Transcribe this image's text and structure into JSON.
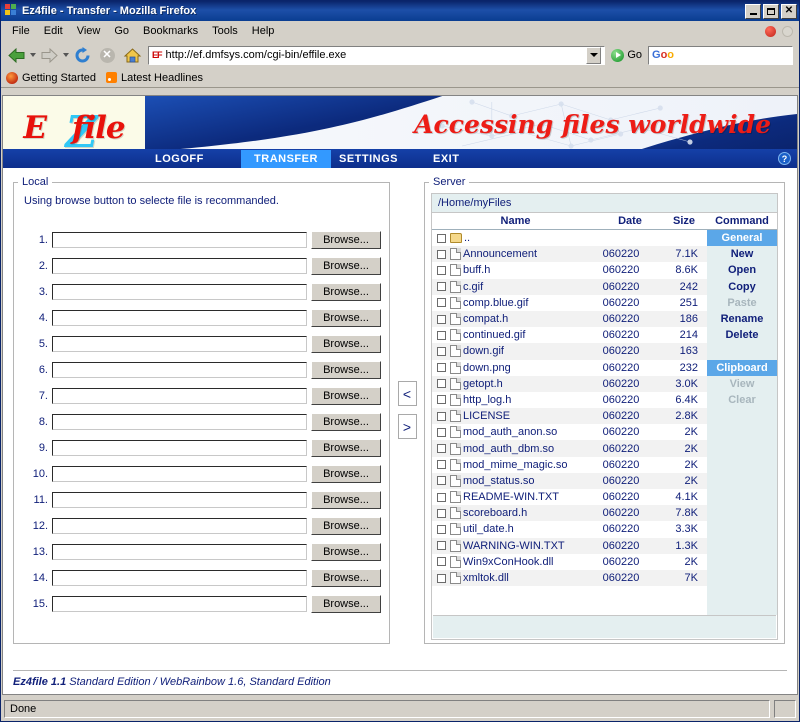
{
  "window": {
    "title": "Ez4file - Transfer - Mozilla Firefox",
    "minimize_label": "Minimize",
    "maximize_label": "Maximize",
    "close_label": "Close"
  },
  "menubar": {
    "items": [
      "File",
      "Edit",
      "View",
      "Go",
      "Bookmarks",
      "Tools",
      "Help"
    ]
  },
  "toolbar": {
    "back_label": "Back",
    "forward_label": "Forward",
    "reload_label": "Reload",
    "stop_label": "Stop",
    "home_label": "Home",
    "url": "http://ef.dmfsys.com/cgi-bin/effile.exe",
    "url_badge": "EF",
    "go_label": "Go",
    "search_placeholder": "",
    "search_value": "",
    "google_logo": [
      "G",
      "o",
      "o"
    ]
  },
  "bookmarks": [
    {
      "label": "Getting Started",
      "icon": "firefox-icon"
    },
    {
      "label": "Latest Headlines",
      "icon": "rss-icon"
    }
  ],
  "banner": {
    "logo_prefix": "E",
    "logo_z": "Z",
    "logo_suffix": "file",
    "tagline": "Accessing files worldwide",
    "help_label": "?"
  },
  "nav": {
    "items": [
      {
        "label": "LOGOFF",
        "active": false
      },
      {
        "label": "TRANSFER",
        "active": true
      },
      {
        "label": "SETTINGS",
        "active": false
      },
      {
        "label": "EXIT",
        "active": false
      }
    ]
  },
  "local": {
    "legend": "Local",
    "hint": "Using browse button to selecte file is recommanded.",
    "browse_label": "Browse...",
    "rows": [
      {
        "num": "1.",
        "value": ""
      },
      {
        "num": "2.",
        "value": ""
      },
      {
        "num": "3.",
        "value": ""
      },
      {
        "num": "4.",
        "value": ""
      },
      {
        "num": "5.",
        "value": ""
      },
      {
        "num": "6.",
        "value": ""
      },
      {
        "num": "7.",
        "value": ""
      },
      {
        "num": "8.",
        "value": ""
      },
      {
        "num": "9.",
        "value": ""
      },
      {
        "num": "10.",
        "value": ""
      },
      {
        "num": "11.",
        "value": ""
      },
      {
        "num": "12.",
        "value": ""
      },
      {
        "num": "13.",
        "value": ""
      },
      {
        "num": "14.",
        "value": ""
      },
      {
        "num": "15.",
        "value": ""
      }
    ]
  },
  "transfer": {
    "to_local_label": "<",
    "to_server_label": ">"
  },
  "server": {
    "legend": "Server",
    "path": "/Home/myFiles",
    "columns": {
      "name": "Name",
      "date": "Date",
      "size": "Size",
      "command": "Command"
    },
    "files": [
      {
        "name": "..",
        "date": "",
        "size": "",
        "icon": "folder-icon"
      },
      {
        "name": "Announcement",
        "date": "060220",
        "size": "7.1K",
        "icon": "file-icon"
      },
      {
        "name": "buff.h",
        "date": "060220",
        "size": "8.6K",
        "icon": "file-icon"
      },
      {
        "name": "c.gif",
        "date": "060220",
        "size": "242",
        "icon": "file-icon"
      },
      {
        "name": "comp.blue.gif",
        "date": "060220",
        "size": "251",
        "icon": "file-icon"
      },
      {
        "name": "compat.h",
        "date": "060220",
        "size": "186",
        "icon": "file-icon"
      },
      {
        "name": "continued.gif",
        "date": "060220",
        "size": "214",
        "icon": "file-icon"
      },
      {
        "name": "down.gif",
        "date": "060220",
        "size": "163",
        "icon": "file-icon"
      },
      {
        "name": "down.png",
        "date": "060220",
        "size": "232",
        "icon": "file-icon"
      },
      {
        "name": "getopt.h",
        "date": "060220",
        "size": "3.0K",
        "icon": "file-icon"
      },
      {
        "name": "http_log.h",
        "date": "060220",
        "size": "6.4K",
        "icon": "file-icon"
      },
      {
        "name": "LICENSE",
        "date": "060220",
        "size": "2.8K",
        "icon": "file-icon"
      },
      {
        "name": "mod_auth_anon.so",
        "date": "060220",
        "size": "2K",
        "icon": "file-icon"
      },
      {
        "name": "mod_auth_dbm.so",
        "date": "060220",
        "size": "2K",
        "icon": "file-icon"
      },
      {
        "name": "mod_mime_magic.so",
        "date": "060220",
        "size": "2K",
        "icon": "file-icon"
      },
      {
        "name": "mod_status.so",
        "date": "060220",
        "size": "2K",
        "icon": "file-icon"
      },
      {
        "name": "README-WIN.TXT",
        "date": "060220",
        "size": "4.1K",
        "icon": "file-icon"
      },
      {
        "name": "scoreboard.h",
        "date": "060220",
        "size": "7.8K",
        "icon": "file-icon"
      },
      {
        "name": "util_date.h",
        "date": "060220",
        "size": "3.3K",
        "icon": "file-icon"
      },
      {
        "name": "WARNING-WIN.TXT",
        "date": "060220",
        "size": "1.3K",
        "icon": "file-icon"
      },
      {
        "name": "Win9xConHook.dll",
        "date": "060220",
        "size": "2K",
        "icon": "file-icon"
      },
      {
        "name": "xmltok.dll",
        "date": "060220",
        "size": "7K",
        "icon": "file-icon"
      }
    ],
    "commands": [
      {
        "label": "General",
        "type": "header",
        "disabled": false
      },
      {
        "label": "New",
        "type": "item",
        "disabled": false
      },
      {
        "label": "Open",
        "type": "item",
        "disabled": false
      },
      {
        "label": "Copy",
        "type": "item",
        "disabled": false
      },
      {
        "label": "Paste",
        "type": "item",
        "disabled": true
      },
      {
        "label": "Rename",
        "type": "item",
        "disabled": false
      },
      {
        "label": "Delete",
        "type": "item",
        "disabled": false
      },
      {
        "label": "",
        "type": "gap",
        "disabled": false
      },
      {
        "label": "Clipboard",
        "type": "header",
        "disabled": false
      },
      {
        "label": "View",
        "type": "item",
        "disabled": true
      },
      {
        "label": "Clear",
        "type": "item",
        "disabled": true
      }
    ]
  },
  "page_footer": {
    "product": "Ez4file 1.1",
    "rest": " Standard Edition / WebRainbow 1.6, Standard Edition"
  },
  "statusbar": {
    "message": "Done"
  },
  "colors": {
    "accent_blue": "#11207a",
    "nav_active": "#3399ff",
    "cmd_header": "#5ba7e8",
    "panel_tint": "#e4eff0",
    "logo_red": "#e8120b",
    "logo_cyan": "#32c8f5"
  }
}
